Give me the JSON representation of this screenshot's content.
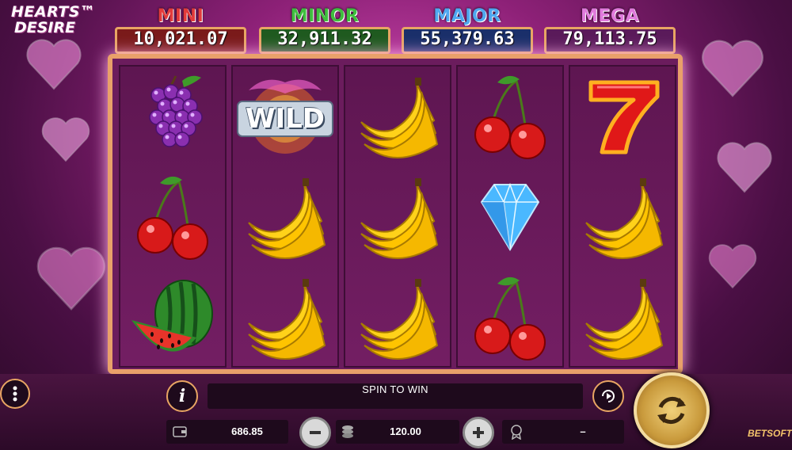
{
  "game": {
    "logo_line1": "HEARTS™",
    "logo_line2": "DESIRE",
    "brand": "BETSOFT"
  },
  "jackpots": [
    {
      "name": "MINI",
      "value": "10,021.07",
      "name_color": "#e23b3b",
      "box_color": "#7a1a1a"
    },
    {
      "name": "MINOR",
      "value": "32,911.32",
      "name_color": "#3fbf3f",
      "box_color": "#1f5a1f"
    },
    {
      "name": "MAJOR",
      "value": "55,379.63",
      "name_color": "#4fa8f0",
      "box_color": "#1a2f6a"
    },
    {
      "name": "MEGA",
      "value": "79,113.75",
      "name_color": "#e07adc",
      "box_color": "#5a1a5a"
    }
  ],
  "reels": [
    [
      "grapes",
      "cherries",
      "watermelon"
    ],
    [
      "wild",
      "banana",
      "banana"
    ],
    [
      "banana",
      "banana",
      "banana"
    ],
    [
      "cherries",
      "diamond",
      "cherries"
    ],
    [
      "seven",
      "banana",
      "banana"
    ]
  ],
  "wild_label": "WILD",
  "controls": {
    "message": "SPIN TO WIN",
    "balance": "686.85",
    "bet": "120.00",
    "win": "–",
    "menu_icon": "more-vertical-icon",
    "info_icon": "info-icon",
    "autoplay_icon": "play-icon",
    "spin_icon": "refresh-icon"
  }
}
